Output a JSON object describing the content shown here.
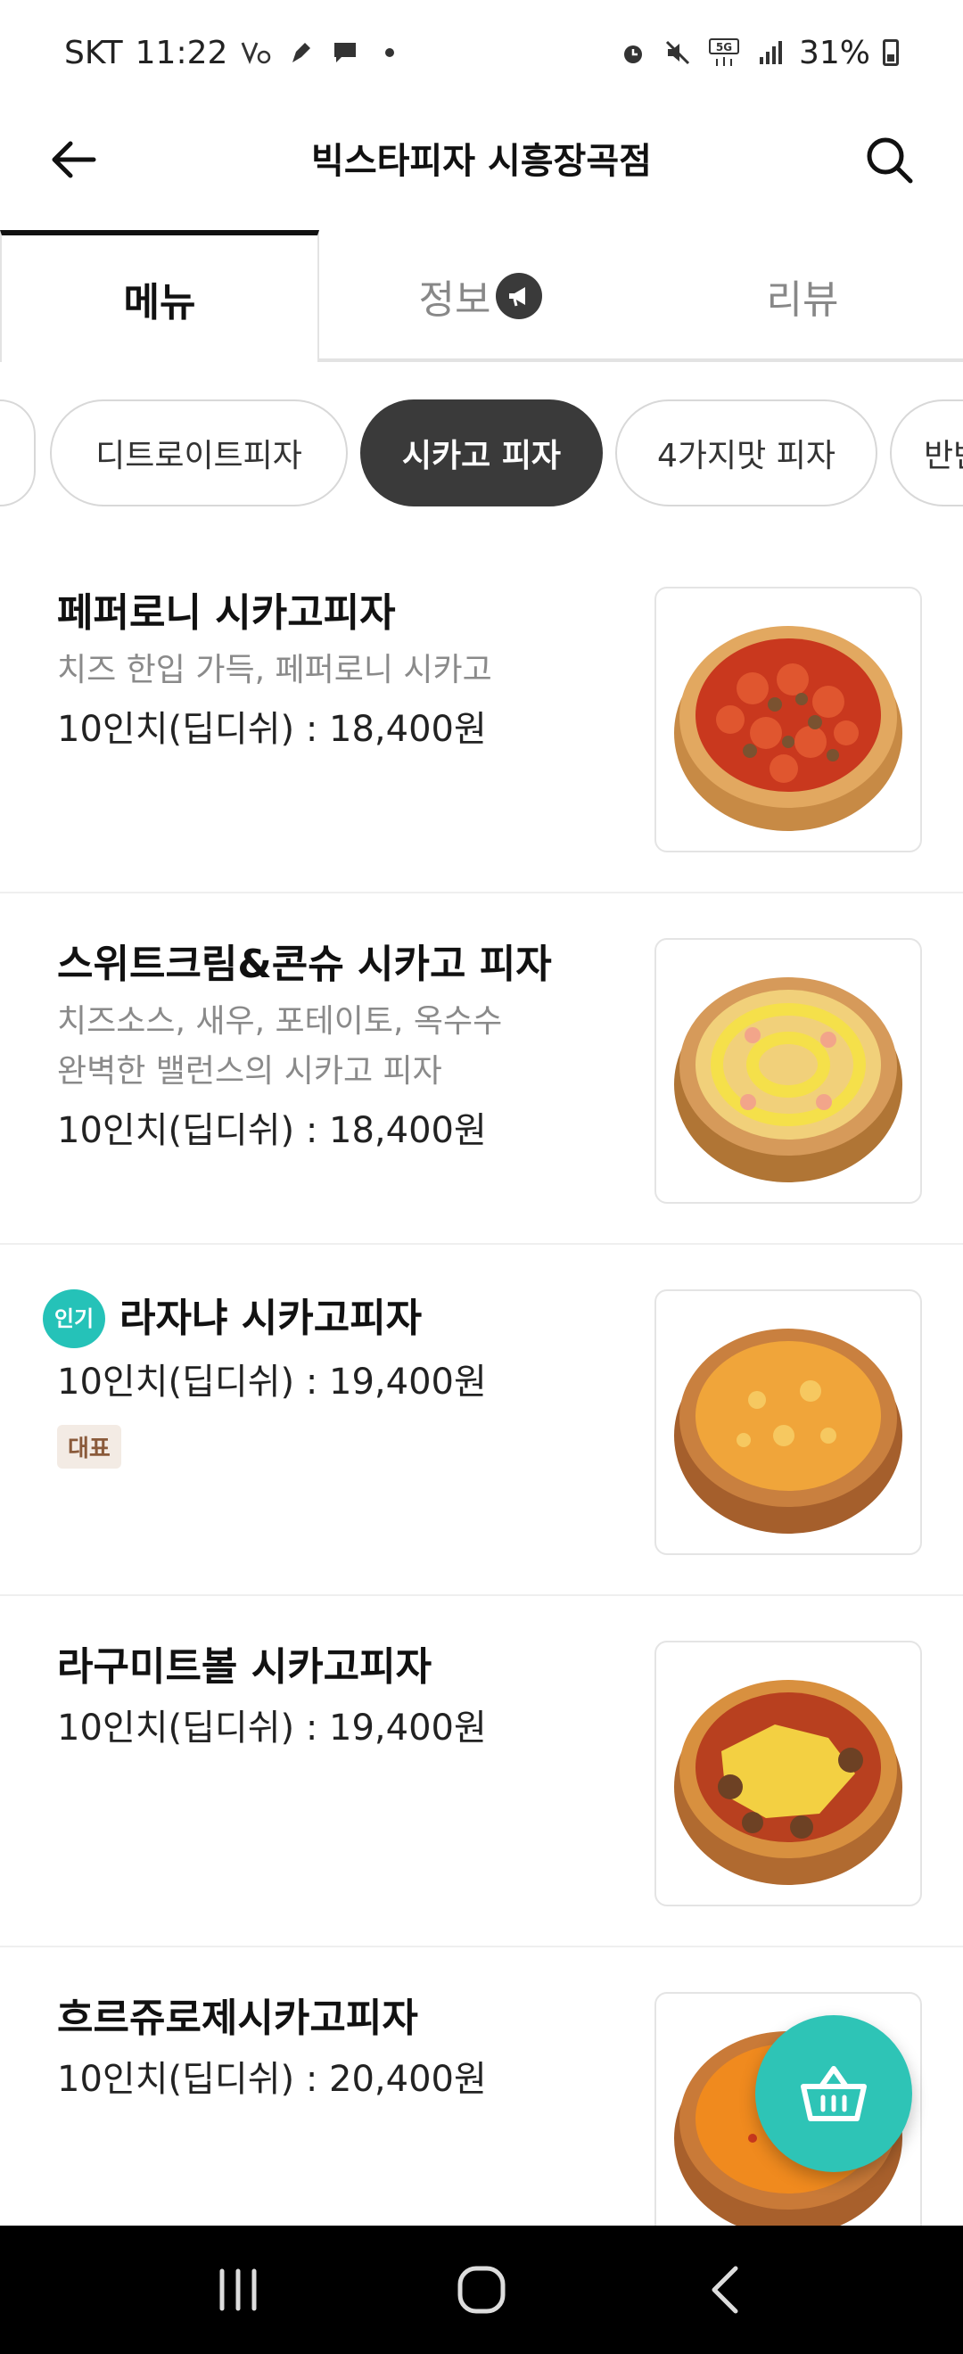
{
  "status_bar": {
    "carrier": "SKT",
    "time": "11:22",
    "battery_percent": "31%",
    "network": "5G"
  },
  "header": {
    "title": "빅스타피자 시흥장곡점"
  },
  "tabs": [
    {
      "label": "메뉴",
      "active": true
    },
    {
      "label": "정보",
      "active": false
    },
    {
      "label": "리뷰",
      "active": false
    }
  ],
  "chips": [
    {
      "label": "디트로이트피자",
      "active": false
    },
    {
      "label": "시카고 피자",
      "active": true
    },
    {
      "label": "4가지맛 피자",
      "active": false
    },
    {
      "label": "반반",
      "active": false
    }
  ],
  "menu": [
    {
      "name": "페퍼로니 시카고피자",
      "desc": [
        "치즈 한입 가득, 페퍼로니 시카고"
      ],
      "price": "10인치(딥디쉬) : 18,400원",
      "popular": false,
      "tag": ""
    },
    {
      "name": "스위트크림&콘슈 시카고 피자",
      "desc": [
        "치즈소스, 새우, 포테이토, 옥수수",
        "완벽한 밸런스의 시카고 피자"
      ],
      "price": "10인치(딥디쉬) : 18,400원",
      "popular": false,
      "tag": ""
    },
    {
      "name": "라자냐 시카고피자",
      "desc": [],
      "price": "10인치(딥디쉬) : 19,400원",
      "popular": true,
      "popular_label": "인기",
      "tag": "대표"
    },
    {
      "name": "라구미트볼 시카고피자",
      "desc": [],
      "price": "10인치(딥디쉬) : 19,400원",
      "popular": false,
      "tag": ""
    },
    {
      "name": "흐르쥬로제시카고피자",
      "desc": [],
      "price": "10인치(딥디쉬) : 20,400원",
      "popular": false,
      "tag": ""
    }
  ],
  "colors": {
    "accent": "#2ec4b6",
    "chip_active": "#3a3a3a",
    "popular_badge": "#25c2b8"
  }
}
